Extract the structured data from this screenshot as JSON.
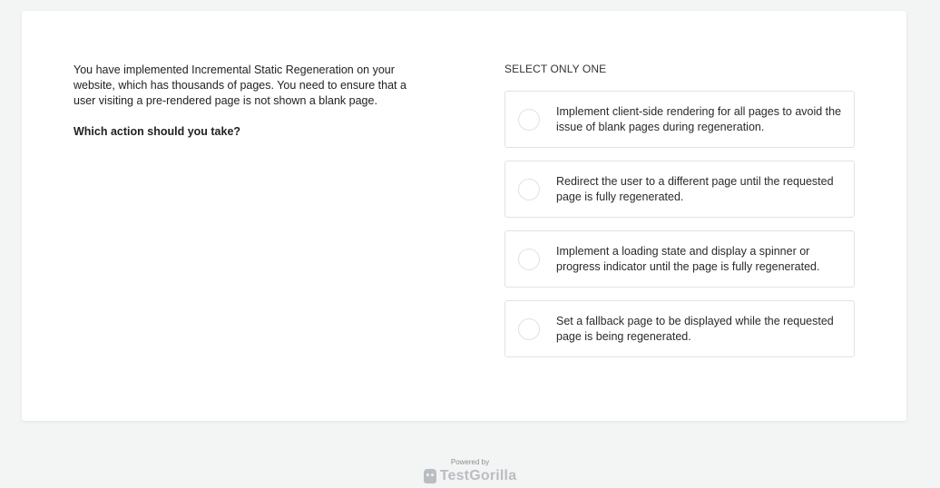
{
  "question": {
    "body": "You have implemented Incremental Static Regeneration on your website, which has thousands of pages. You need to ensure that a user visiting a pre-rendered page is not shown a blank page.",
    "prompt": "Which action should you take?"
  },
  "answers": {
    "instruction": "SELECT ONLY ONE",
    "options": [
      {
        "label": "Implement client-side rendering for all pages to avoid the issue of blank pages during regeneration.",
        "selected": false
      },
      {
        "label": "Redirect the user to a different page until the requested page is fully regenerated.",
        "selected": false
      },
      {
        "label": "Implement a loading state and display a spinner or progress indicator until the page is fully regenerated.",
        "selected": false
      },
      {
        "label": "Set a fallback page to be displayed while the requested page is being regenerated.",
        "selected": false
      }
    ]
  },
  "footer": {
    "powered_by": "Powered by",
    "brand": "TestGorilla",
    "brand_icon": "gorilla-logo-icon"
  },
  "colors": {
    "background": "#f3f4f4",
    "card": "#ffffff",
    "border": "#e1e3e3",
    "text": "#222222"
  }
}
